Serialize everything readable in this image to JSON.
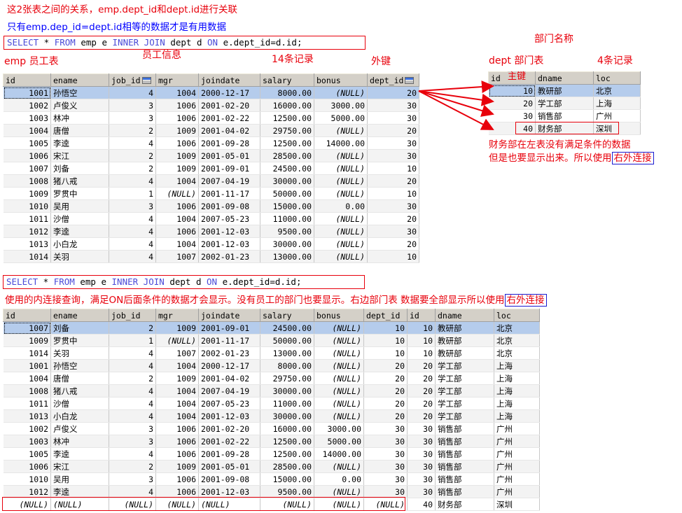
{
  "top_notes": {
    "line1": "这2张表之间的关系，emp.dept_id和dept.id进行关联",
    "line2": "只有emp.dep_id=dept.id相等的数据才是有用数据"
  },
  "sql1": {
    "kw1": "SELECT",
    "star": " * ",
    "kw2": "FROM",
    "t1": " emp e ",
    "kw3": "INNER JOIN",
    "t2": " dept d ",
    "kw4": "ON",
    "cond": " e.dept_id=d.id;"
  },
  "labels": {
    "emp_table": "emp 员工表",
    "emp_info": "员工信息",
    "emp_count": "14条记录",
    "foreign_key": "外键",
    "dept_name": "部门名称",
    "dept_table": "dept 部门表",
    "dept_count": "4条记录",
    "primary_key": "主键",
    "finance_note1": "财务部在左表没有满足条件的数据",
    "finance_note2": "但是也要显示出来。所以使用",
    "finance_note2_box": "右外连接"
  },
  "emp_table": {
    "columns": [
      "id",
      "ename",
      "job_id",
      "mgr",
      "joindate",
      "salary",
      "bonus",
      "dept_id"
    ],
    "rows": [
      [
        "1001",
        "孙悟空",
        "4",
        "1004",
        "2000-12-17",
        "8000.00",
        "(NULL)",
        "20"
      ],
      [
        "1002",
        "卢俊义",
        "3",
        "1006",
        "2001-02-20",
        "16000.00",
        "3000.00",
        "30"
      ],
      [
        "1003",
        "林冲",
        "3",
        "1006",
        "2001-02-22",
        "12500.00",
        "5000.00",
        "30"
      ],
      [
        "1004",
        "唐僧",
        "2",
        "1009",
        "2001-04-02",
        "29750.00",
        "(NULL)",
        "20"
      ],
      [
        "1005",
        "李逵",
        "4",
        "1006",
        "2001-09-28",
        "12500.00",
        "14000.00",
        "30"
      ],
      [
        "1006",
        "宋江",
        "2",
        "1009",
        "2001-05-01",
        "28500.00",
        "(NULL)",
        "30"
      ],
      [
        "1007",
        "刘备",
        "2",
        "1009",
        "2001-09-01",
        "24500.00",
        "(NULL)",
        "10"
      ],
      [
        "1008",
        "猪八戒",
        "4",
        "1004",
        "2007-04-19",
        "30000.00",
        "(NULL)",
        "20"
      ],
      [
        "1009",
        "罗贯中",
        "1",
        "(NULL)",
        "2001-11-17",
        "50000.00",
        "(NULL)",
        "10"
      ],
      [
        "1010",
        "吴用",
        "3",
        "1006",
        "2001-09-08",
        "15000.00",
        "0.00",
        "30"
      ],
      [
        "1011",
        "沙僧",
        "4",
        "1004",
        "2007-05-23",
        "11000.00",
        "(NULL)",
        "20"
      ],
      [
        "1012",
        "李逵",
        "4",
        "1006",
        "2001-12-03",
        "9500.00",
        "(NULL)",
        "30"
      ],
      [
        "1013",
        "小白龙",
        "4",
        "1004",
        "2001-12-03",
        "30000.00",
        "(NULL)",
        "20"
      ],
      [
        "1014",
        "关羽",
        "4",
        "1007",
        "2002-01-23",
        "13000.00",
        "(NULL)",
        "10"
      ]
    ]
  },
  "dept_table": {
    "columns": [
      "id",
      "dname",
      "loc"
    ],
    "rows": [
      [
        "10",
        "教研部",
        "北京"
      ],
      [
        "20",
        "学工部",
        "上海"
      ],
      [
        "30",
        "销售部",
        "广州"
      ],
      [
        "40",
        "财务部",
        "深圳"
      ]
    ]
  },
  "sql2": {
    "kw1": "SELECT",
    "star": " * ",
    "kw2": "FROM",
    "t1": " emp e ",
    "kw3": "INNER JOIN",
    "t2": " dept d ",
    "kw4": "ON",
    "cond": " e.dept_id=d.id;"
  },
  "inner_join_note": {
    "text": "使用的内连接查询，满足ON后面条件的数据才会显示。没有员工的部门也要显示。右边部门表 数据要全部显示所以使用",
    "boxed": "右外连接"
  },
  "join_table": {
    "columns": [
      "id",
      "ename",
      "job_id",
      "mgr",
      "joindate",
      "salary",
      "bonus",
      "dept_id",
      "id",
      "dname",
      "loc"
    ],
    "rows": [
      [
        "1007",
        "刘备",
        "2",
        "1009",
        "2001-09-01",
        "24500.00",
        "(NULL)",
        "10",
        "10",
        "教研部",
        "北京"
      ],
      [
        "1009",
        "罗贯中",
        "1",
        "(NULL)",
        "2001-11-17",
        "50000.00",
        "(NULL)",
        "10",
        "10",
        "教研部",
        "北京"
      ],
      [
        "1014",
        "关羽",
        "4",
        "1007",
        "2002-01-23",
        "13000.00",
        "(NULL)",
        "10",
        "10",
        "教研部",
        "北京"
      ],
      [
        "1001",
        "孙悟空",
        "4",
        "1004",
        "2000-12-17",
        "8000.00",
        "(NULL)",
        "20",
        "20",
        "学工部",
        "上海"
      ],
      [
        "1004",
        "唐僧",
        "2",
        "1009",
        "2001-04-02",
        "29750.00",
        "(NULL)",
        "20",
        "20",
        "学工部",
        "上海"
      ],
      [
        "1008",
        "猪八戒",
        "4",
        "1004",
        "2007-04-19",
        "30000.00",
        "(NULL)",
        "20",
        "20",
        "学工部",
        "上海"
      ],
      [
        "1011",
        "沙僧",
        "4",
        "1004",
        "2007-05-23",
        "11000.00",
        "(NULL)",
        "20",
        "20",
        "学工部",
        "上海"
      ],
      [
        "1013",
        "小白龙",
        "4",
        "1004",
        "2001-12-03",
        "30000.00",
        "(NULL)",
        "20",
        "20",
        "学工部",
        "上海"
      ],
      [
        "1002",
        "卢俊义",
        "3",
        "1006",
        "2001-02-20",
        "16000.00",
        "3000.00",
        "30",
        "30",
        "销售部",
        "广州"
      ],
      [
        "1003",
        "林冲",
        "3",
        "1006",
        "2001-02-22",
        "12500.00",
        "5000.00",
        "30",
        "30",
        "销售部",
        "广州"
      ],
      [
        "1005",
        "李逵",
        "4",
        "1006",
        "2001-09-28",
        "12500.00",
        "14000.00",
        "30",
        "30",
        "销售部",
        "广州"
      ],
      [
        "1006",
        "宋江",
        "2",
        "1009",
        "2001-05-01",
        "28500.00",
        "(NULL)",
        "30",
        "30",
        "销售部",
        "广州"
      ],
      [
        "1010",
        "吴用",
        "3",
        "1006",
        "2001-09-08",
        "15000.00",
        "0.00",
        "30",
        "30",
        "销售部",
        "广州"
      ],
      [
        "1012",
        "李逵",
        "4",
        "1006",
        "2001-12-03",
        "9500.00",
        "(NULL)",
        "30",
        "30",
        "销售部",
        "广州"
      ],
      [
        "(NULL)",
        "(NULL)",
        "(NULL)",
        "(NULL)",
        "(NULL)",
        "(NULL)",
        "(NULL)",
        "(NULL)",
        "40",
        "财务部",
        "深圳"
      ]
    ]
  },
  "colors": {
    "annotation_red": "#e8000b",
    "annotation_blue": "#0000ff",
    "keyword": "#4a4ad8",
    "selected_row": "#b5ccec",
    "header_bg": "#d4d0c8"
  }
}
